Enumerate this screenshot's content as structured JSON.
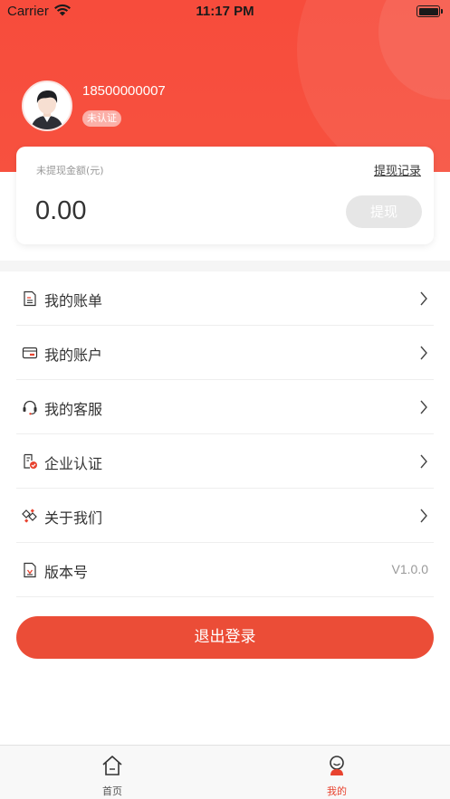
{
  "status_bar": {
    "carrier": "Carrier",
    "time": "11:17 PM"
  },
  "profile": {
    "phone": "18500000007",
    "cert_status": "未认证"
  },
  "balance_card": {
    "label": "未提现金额(元)",
    "record_link": "提现记录",
    "amount": "0.00",
    "withdraw_button": "提现"
  },
  "menu": {
    "items": [
      {
        "label": "我的账单",
        "icon": "bill-icon"
      },
      {
        "label": "我的账户",
        "icon": "card-icon"
      },
      {
        "label": "我的客服",
        "icon": "headset-icon"
      },
      {
        "label": "企业认证",
        "icon": "certificate-icon"
      },
      {
        "label": "关于我们",
        "icon": "about-icon"
      },
      {
        "label": "版本号",
        "icon": "document-icon",
        "value": "V1.0.0"
      }
    ]
  },
  "logout_button": "退出登录",
  "tabbar": {
    "tabs": [
      {
        "label": "首页",
        "icon": "home-icon",
        "active": false
      },
      {
        "label": "我的",
        "icon": "user-icon",
        "active": true
      }
    ]
  },
  "colors": {
    "brand_red": "#f74c3c",
    "logout_red": "#eb4d37",
    "active_tab": "#e8432f",
    "disabled_button": "#e6e6e6"
  }
}
